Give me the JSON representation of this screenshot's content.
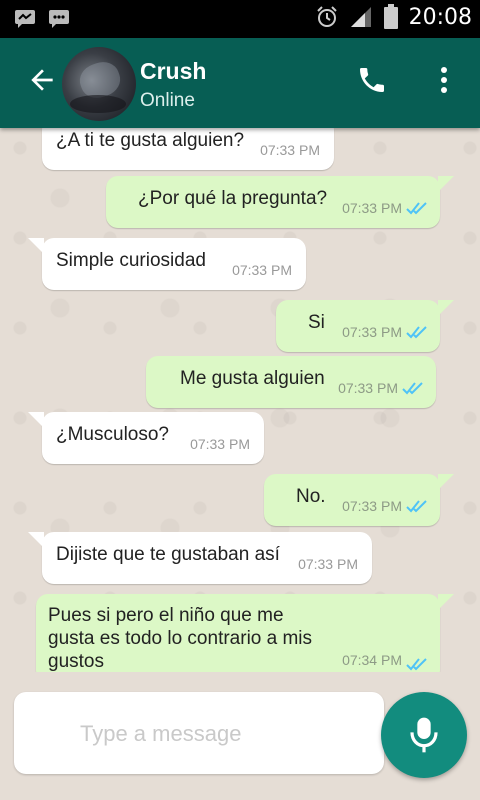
{
  "status_bar": {
    "time": "20:08",
    "icons": [
      "chat-notification-icon",
      "sms-notification-icon",
      "alarm-icon",
      "signal-icon",
      "battery-icon"
    ]
  },
  "header": {
    "contact_name": "Crush",
    "contact_status": "Online"
  },
  "messages": [
    {
      "direction": "in",
      "text": "¿A ti te gusta alguien?",
      "time": "07:33 PM"
    },
    {
      "direction": "out",
      "text": "¿Por qué la pregunta?",
      "time": "07:33 PM",
      "read": true
    },
    {
      "direction": "in",
      "text": "Simple curiosidad",
      "time": "07:33 PM"
    },
    {
      "direction": "out",
      "text": "Si",
      "time": "07:33 PM",
      "read": true
    },
    {
      "direction": "out",
      "text": "Me gusta alguien",
      "time": "07:33 PM",
      "read": true
    },
    {
      "direction": "in",
      "text": "¿Musculoso?",
      "time": "07:33 PM"
    },
    {
      "direction": "out",
      "text": "No.",
      "time": "07:33 PM",
      "read": true
    },
    {
      "direction": "in",
      "text": "Dijiste que te gustaban así",
      "time": "07:33 PM"
    },
    {
      "direction": "out",
      "text": "Pues si pero el niño que me gusta es todo lo contrario a mis gustos",
      "time": "07:34 PM",
      "read": true
    }
  ],
  "composer": {
    "placeholder": "Type a message"
  },
  "colors": {
    "header": "#075e54",
    "incoming_bubble": "#ffffff",
    "outgoing_bubble": "#dcf8c6",
    "read_ticks": "#4fc3f7",
    "mic_button": "#128c7e",
    "chat_background": "#e5ddd5"
  }
}
